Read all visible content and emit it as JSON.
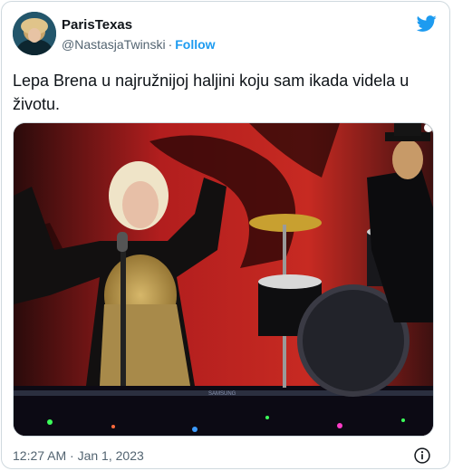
{
  "author": {
    "display_name": "ParisTexas",
    "handle": "@NastasjaTwinski",
    "separator": "·",
    "follow_label": "Follow"
  },
  "tweet": {
    "text": "Lepa Brena u najružnijoj haljini koju sam ikada videla u životu."
  },
  "media": {
    "description_icon": "concert-photo",
    "stage_brand": "SAMSUNG"
  },
  "footer": {
    "timestamp": "12:27 AM · Jan 1, 2023"
  },
  "colors": {
    "accent": "#1d9bf0",
    "text": "#0f1419",
    "secondary": "#536471",
    "border": "#cfd9de"
  },
  "icons": {
    "brand": "twitter-bird-icon",
    "info": "info-icon"
  }
}
